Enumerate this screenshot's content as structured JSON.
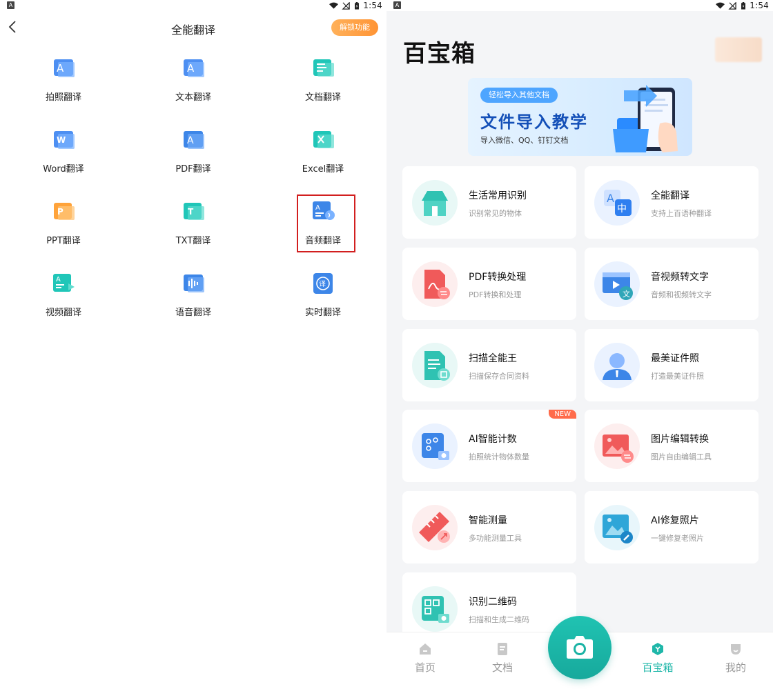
{
  "status_left": {
    "time": "1:54"
  },
  "status_right": {
    "time": "1:54"
  },
  "translate": {
    "title": "全能翻译",
    "unlock_label": "解锁功能",
    "items": [
      {
        "label": "拍照翻译",
        "icon": "photo-translate-icon"
      },
      {
        "label": "文本翻译",
        "icon": "text-translate-icon"
      },
      {
        "label": "文档翻译",
        "icon": "document-translate-icon"
      },
      {
        "label": "Word翻译",
        "icon": "word-translate-icon"
      },
      {
        "label": "PDF翻译",
        "icon": "pdf-translate-icon"
      },
      {
        "label": "Excel翻译",
        "icon": "excel-translate-icon"
      },
      {
        "label": "PPT翻译",
        "icon": "ppt-translate-icon"
      },
      {
        "label": "TXT翻译",
        "icon": "txt-translate-icon"
      },
      {
        "label": "音频翻译",
        "icon": "audio-translate-icon"
      },
      {
        "label": "视频翻译",
        "icon": "video-translate-icon"
      },
      {
        "label": "语音翻译",
        "icon": "voice-translate-icon"
      },
      {
        "label": "实时翻译",
        "icon": "realtime-translate-icon"
      }
    ]
  },
  "toolbox": {
    "title": "百宝箱",
    "banner": {
      "pill": "轻松导入其他文档",
      "headline": "文件导入教学",
      "caption": "导入微信、QQ、钉钉文档"
    },
    "cards": [
      {
        "title": "生活常用识别",
        "sub": "识别常见的物体",
        "icon": "house-icon"
      },
      {
        "title": "全能翻译",
        "sub": "支持上百语种翻译",
        "icon": "translate-icon"
      },
      {
        "title": "PDF转换处理",
        "sub": "PDF转换和处理",
        "icon": "pdf-convert-icon"
      },
      {
        "title": "音视频转文字",
        "sub": "音频和视频转文字",
        "icon": "media-to-text-icon"
      },
      {
        "title": "扫描全能王",
        "sub": "扫描保存合同资料",
        "icon": "scan-document-icon"
      },
      {
        "title": "最美证件照",
        "sub": "打造最美证件照",
        "icon": "id-photo-icon"
      },
      {
        "title": "AI智能计数",
        "sub": "拍照统计物体数量",
        "icon": "ai-count-icon",
        "badge": "NEW"
      },
      {
        "title": "图片编辑转换",
        "sub": "图片自由编辑工具",
        "icon": "image-edit-icon"
      },
      {
        "title": "智能测量",
        "sub": "多功能测量工具",
        "icon": "ruler-icon"
      },
      {
        "title": "AI修复照片",
        "sub": "一键修复老照片",
        "icon": "photo-repair-icon"
      },
      {
        "title": "识别二维码",
        "sub": "扫描和生成二维码",
        "icon": "qr-code-icon"
      }
    ],
    "tabs": [
      {
        "label": "首页",
        "icon": "home-icon"
      },
      {
        "label": "文档",
        "icon": "document-icon"
      },
      {
        "label": "百宝箱",
        "icon": "toolbox-icon",
        "active": true
      },
      {
        "label": "我的",
        "icon": "profile-icon"
      }
    ],
    "fab_icon": "camera-icon"
  },
  "colors": {
    "accent": "#1fb7a9",
    "unlock": "#ff9c3d",
    "highlight": "#d21f1f",
    "new_badge": "#ff6b4a"
  }
}
